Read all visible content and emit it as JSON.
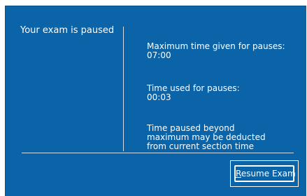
{
  "dialog": {
    "status_title": "Your exam is paused",
    "max_time": {
      "label": "Maximum time given for pauses:",
      "value": "07:00"
    },
    "time_used": {
      "label": "Time used for pauses:",
      "value": "00:03"
    },
    "warning_lines": [
      "Time paused beyond",
      "maximum may be deducted",
      "from current section time"
    ],
    "resume_button": {
      "mnemonic": "R",
      "label_rest": "esume Exam"
    }
  },
  "colors": {
    "panel_background": "#0b63a8",
    "text": "#ffffff",
    "divider": "#d3deea"
  }
}
